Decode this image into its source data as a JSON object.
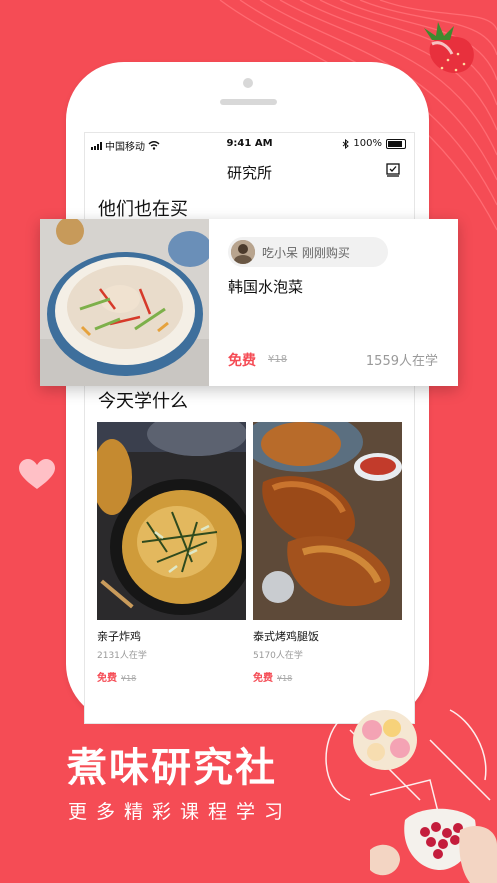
{
  "status_bar": {
    "carrier": "中国移动",
    "time": "9:41 AM",
    "battery": "100%"
  },
  "nav": {
    "title": "研究所"
  },
  "purchases": {
    "heading": "他们也在买",
    "user_name": "吃小呆",
    "action": "刚刚购买",
    "title": "韩国水泡菜",
    "price_free": "免费",
    "price_old": "¥18",
    "learners": "1559人在学"
  },
  "today": {
    "heading": "今天学什么",
    "courses": [
      {
        "title": "亲子炸鸡",
        "learners": "2131人在学",
        "price_free": "免费",
        "price_old": "¥18"
      },
      {
        "title": "泰式烤鸡腿饭",
        "learners": "5170人在学",
        "price_free": "免费",
        "price_old": "¥18"
      }
    ]
  },
  "promo": {
    "brand": "煮味研究社",
    "tagline": "更多精彩课程学习"
  },
  "colors": {
    "accent": "#f54c55"
  }
}
